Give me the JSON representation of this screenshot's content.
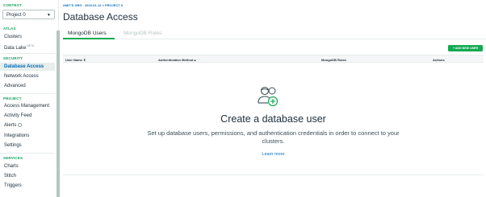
{
  "sidebar": {
    "context_label": "CONTEXT",
    "project_value": "Project 0",
    "atlas_label": "ATLAS",
    "atlas_items": [
      {
        "label": "Clusters"
      },
      {
        "label": "Data Lake",
        "badge": "BETA"
      }
    ],
    "security_label": "SECURITY",
    "security_items": [
      {
        "label": "Database Access"
      },
      {
        "label": "Network Access"
      },
      {
        "label": "Advanced"
      }
    ],
    "project_label": "PROJECT",
    "project_items": [
      {
        "label": "Access Management"
      },
      {
        "label": "Activity Feed"
      },
      {
        "label": "Alerts"
      },
      {
        "label": "Integrations"
      },
      {
        "label": "Settings"
      }
    ],
    "services_label": "SERVICES",
    "services_items": [
      {
        "label": "Charts"
      },
      {
        "label": "Stitch"
      },
      {
        "label": "Triggers"
      }
    ]
  },
  "header": {
    "breadcrumb": "AMIT'S ORG - 2020-01-12 > PROJECT 0",
    "title": "Database Access"
  },
  "tabs": [
    {
      "label": "MongoDB Users"
    },
    {
      "label": "MongoDB Roles"
    }
  ],
  "toolbar": {
    "add_user_label": "+ ADD NEW USER"
  },
  "table": {
    "columns": [
      "User Name ⇕",
      "Authentication Method ▴",
      "MongoDB Roles",
      "Actions"
    ]
  },
  "empty_state": {
    "title": "Create a database user",
    "description": "Set up database users, permissions, and authentication credentials in order to connect to your clusters.",
    "link": "Learn more"
  },
  "colors": {
    "accent_green": "#13aa52",
    "link_blue": "#006cbc",
    "section_green": "#0f9d58"
  }
}
